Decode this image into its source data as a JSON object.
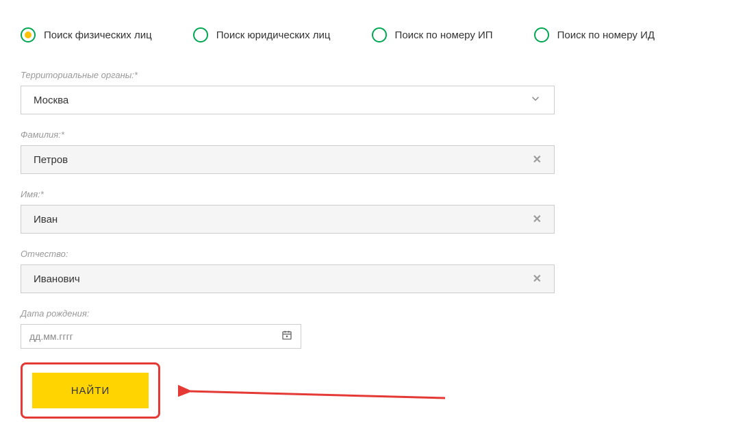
{
  "tabs": [
    {
      "label": "Поиск физических лиц",
      "selected": true
    },
    {
      "label": "Поиск юридических лиц",
      "selected": false
    },
    {
      "label": "Поиск по номеру ИП",
      "selected": false
    },
    {
      "label": "Поиск по номеру ИД",
      "selected": false
    }
  ],
  "fields": {
    "territory": {
      "label": "Территориальные органы:*",
      "value": "Москва"
    },
    "surname": {
      "label": "Фамилия:*",
      "value": "Петров"
    },
    "name": {
      "label": "Имя:*",
      "value": "Иван"
    },
    "patronymic": {
      "label": "Отчество:",
      "value": "Иванович"
    },
    "birthdate": {
      "label": "Дата рождения:",
      "placeholder": "дд.мм.гггг"
    }
  },
  "submit_label": "НАЙТИ"
}
